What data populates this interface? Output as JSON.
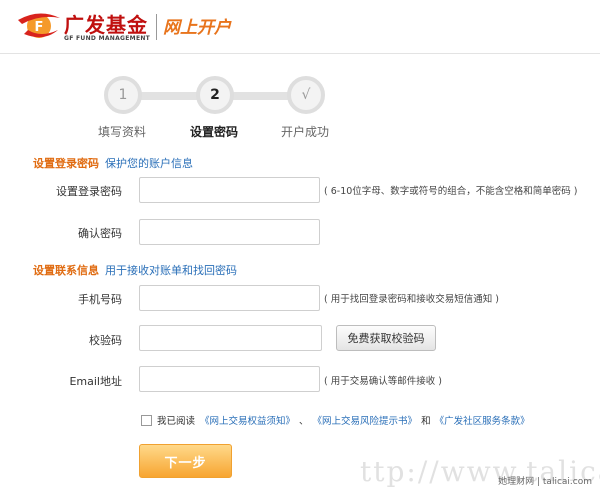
{
  "header": {
    "brand_name": "广发基金",
    "brand_en": "GF FUND MANAGEMENT",
    "page_title": "网上开户",
    "brand_color": "#c0100f",
    "accent_color": "#e8741c"
  },
  "steps": [
    {
      "number": "1",
      "label": "填写资料",
      "state": "done"
    },
    {
      "number": "2",
      "label": "设置密码",
      "state": "active"
    },
    {
      "number": "√",
      "label": "开户成功",
      "state": "pending"
    }
  ],
  "login_section": {
    "title": "设置登录密码",
    "subtitle": "保护您的账户信息",
    "password_label": "设置登录密码",
    "password_value": "",
    "password_hint": "( 6-10位字母、数字或符号的组合，不能含空格和简单密码 )",
    "confirm_label": "确认密码",
    "confirm_value": ""
  },
  "contact_section": {
    "title": "设置联系信息",
    "subtitle": "用于接收对账单和找回密码",
    "phone_label": "手机号码",
    "phone_value": "",
    "phone_hint": "( 用于找回登录密码和接收交易短信通知 )",
    "code_label": "校验码",
    "code_value": "",
    "sms_button_label": "免费获取校验码",
    "email_label": "Email地址",
    "email_value": "",
    "email_hint": "( 用于交易确认等邮件接收 )"
  },
  "agreement": {
    "checked": false,
    "prefix": "我已阅读",
    "link1": "《网上交易权益须知》",
    "sep1": "、",
    "link2": "《网上交易风险提示书》",
    "sep2": "和",
    "link3": "《广发社区服务条款》"
  },
  "next_button_label": "下一步",
  "watermark_text": "ttp://www.talicai.com",
  "watermark_corner_text": "她理财网 | talicai.com"
}
